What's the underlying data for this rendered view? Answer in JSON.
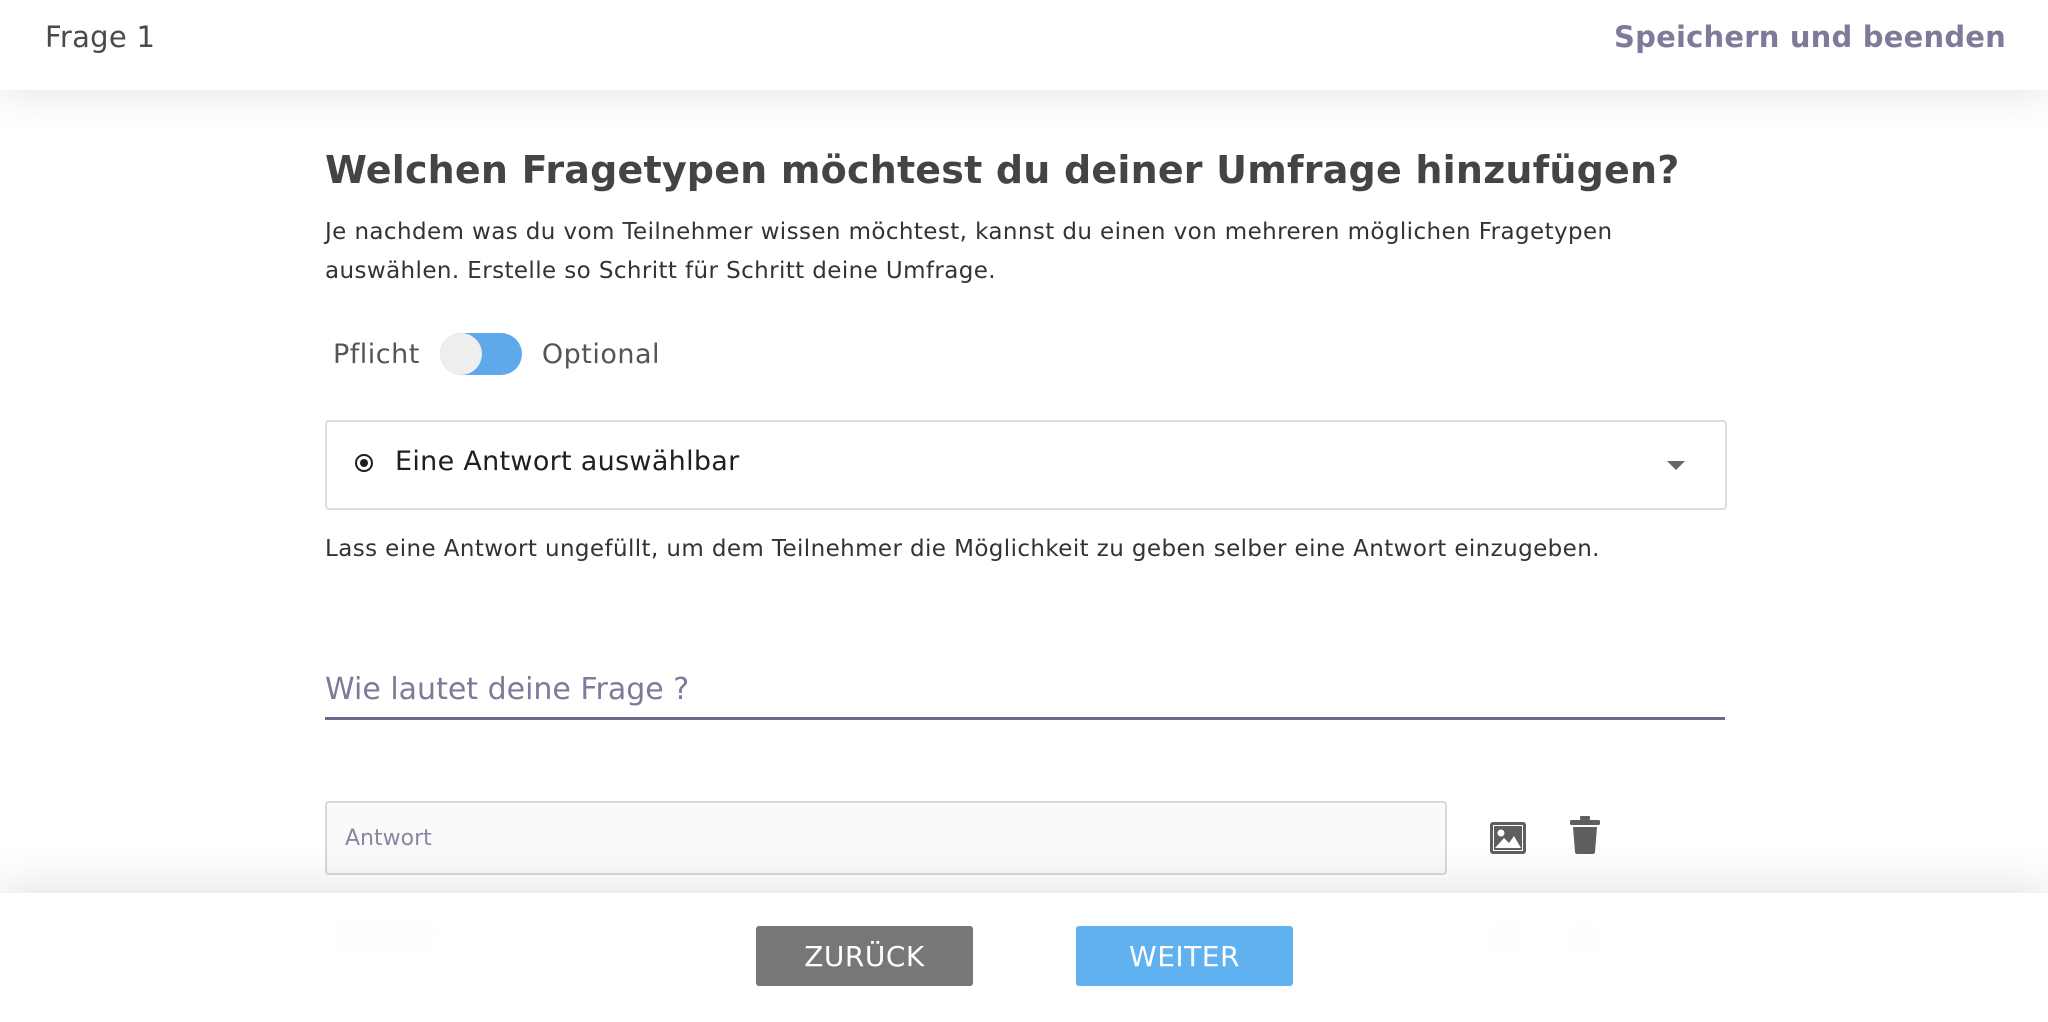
{
  "header": {
    "question_label": "Frage 1",
    "save_exit_label": "Speichern und beenden"
  },
  "main": {
    "title": "Welchen Fragetypen möchtest du deiner Umfrage hinzufügen?",
    "description": "Je nachdem was du vom Teilnehmer wissen möchtest, kannst du einen von mehreren möglichen Fragetypen auswählen. Erstelle so Schritt für Schritt deine Umfrage.",
    "toggle": {
      "left_label": "Pflicht",
      "right_label": "Optional",
      "selected": "Optional"
    },
    "question_type": {
      "selected_label": "Eine Antwort auswählbar",
      "icon": "radio-button-checked-icon"
    },
    "hint": "Lass eine Antwort ungefüllt, um dem Teilnehmer die Möglichkeit zu geben selber eine Antwort einzugeben.",
    "question_field": {
      "placeholder": "Wie lautet deine Frage ?",
      "value": ""
    },
    "answer_field": {
      "placeholder": "Antwort",
      "value": ""
    },
    "answer_icons": [
      "image-icon",
      "trash-icon"
    ]
  },
  "footer": {
    "back_label": "ZURÜCK",
    "next_label": "WEITER"
  },
  "colors": {
    "accent_blue": "#60b1f0",
    "back_gray": "#777777",
    "muted_purple": "#7f7a9a",
    "underline": "#6e6a8e"
  }
}
